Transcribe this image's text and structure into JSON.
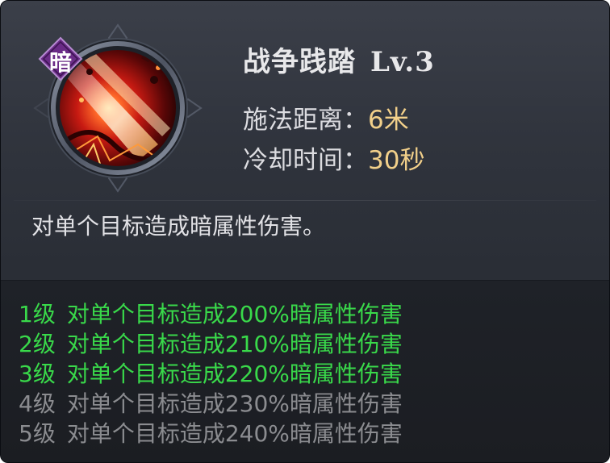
{
  "skill": {
    "element_badge": "暗",
    "name": "战争践踏",
    "level": "Lv.3",
    "range_label": "施法距离：",
    "range_value": "6米",
    "cooldown_label": "冷却时间：",
    "cooldown_value": "30秒",
    "description": "对单个目标造成暗属性伤害。"
  },
  "levels": [
    {
      "level": "1级",
      "text": "对单个目标造成200%暗属性伤害",
      "unlocked": true
    },
    {
      "level": "2级",
      "text": "对单个目标造成210%暗属性伤害",
      "unlocked": true
    },
    {
      "level": "3级",
      "text": "对单个目标造成220%暗属性伤害",
      "unlocked": true
    },
    {
      "level": "4级",
      "text": "对单个目标造成230%暗属性伤害",
      "unlocked": false
    },
    {
      "level": "5级",
      "text": "对单个目标造成240%暗属性伤害",
      "unlocked": false
    }
  ],
  "colors": {
    "active_level": "#39d94a",
    "inactive_level": "#8b8c90",
    "stat_value": "#f2d08a",
    "badge_purple": "#6a2b86"
  },
  "icons": {
    "skill_icon": "war-stomp-fire-slash-icon",
    "badge_icon": "dark-element-diamond-icon"
  }
}
